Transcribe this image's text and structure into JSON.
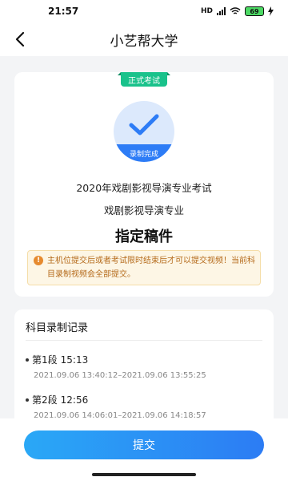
{
  "status_bar": {
    "time": "21:57",
    "network_label": "HD",
    "battery": "69"
  },
  "nav": {
    "title": "小艺帮大学",
    "back_icon": "chevron-left-icon"
  },
  "exam": {
    "tag": "正式考试",
    "record_status": "录制完成",
    "exam_name": "2020年戏剧影视导演专业考试",
    "major": "戏剧影视导演专业",
    "subject": "指定稿件",
    "notice": "主机位提交后或者考试限时结束后才可以提交视频！当前科目录制视频会全部提交。"
  },
  "records": {
    "title": "科目录制记录",
    "items": [
      {
        "label": "第1段",
        "duration": "15:13",
        "range": "2021.09.06 13:40:12–2021.09.06 13:55:25"
      },
      {
        "label": "第2段",
        "duration": "12:56",
        "range": "2021.09.06 14:06:01–2021.09.06 14:18:57"
      }
    ]
  },
  "actions": {
    "submit_label": "提交"
  },
  "colors": {
    "accent": "#2d7cf6",
    "tag_green": "#19c28b",
    "notice_text": "#b56a1a",
    "notice_bg": "#fdf6e5"
  }
}
